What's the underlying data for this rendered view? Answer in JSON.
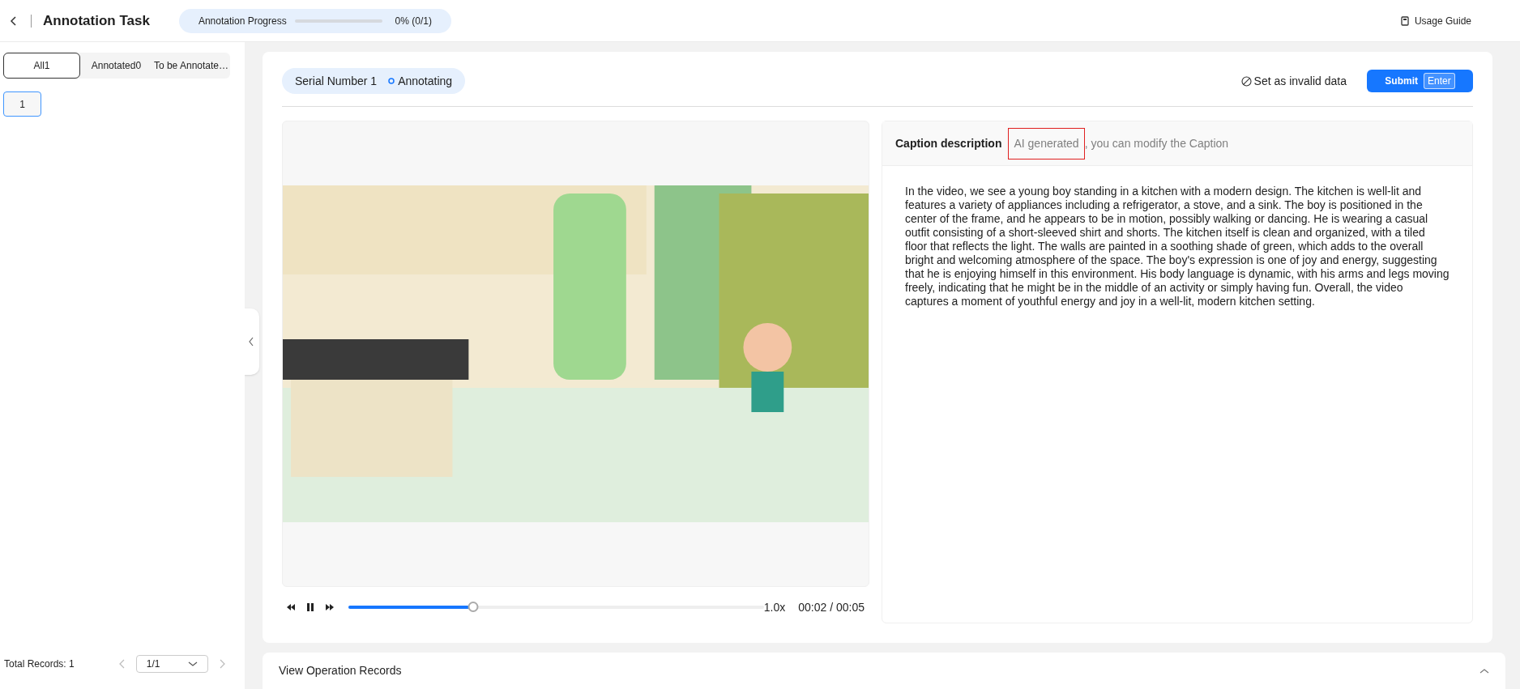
{
  "header": {
    "title": "Annotation Task",
    "progress": {
      "label": "Annotation Progress",
      "level": 0,
      "reading": "0% (0/1)"
    },
    "guide": "Usage Guide"
  },
  "sidebar": {
    "tabs": [
      {
        "label": "All1",
        "selected": true
      },
      {
        "label": "Annotated0",
        "selected": false
      },
      {
        "label": "To be Annotate…",
        "selected": false
      }
    ],
    "items": [
      {
        "label": "1",
        "selected": true
      }
    ],
    "total": "Total Records: 1",
    "page": "1/1"
  },
  "task": {
    "serial": "Serial Number 1",
    "status": "Annotating",
    "invalid": "Set as invalid data",
    "submit": "Submit",
    "submit_key": "Enter"
  },
  "player": {
    "level": 0.3,
    "speed": "1.0x",
    "time": "00:02 / 00:05"
  },
  "caption": {
    "title": "Caption description",
    "hint": [
      {
        "text": "AI generated",
        "highlighted": true
      },
      {
        "text": ", you can modify the Caption",
        "highlighted": false
      }
    ],
    "text": "In the video, we see a young boy standing in a kitchen with a modern design. The kitchen is well-lit and features a variety of appliances including a refrigerator, a stove, and a sink. The boy is positioned in the center of the frame, and he appears to be in motion, possibly walking or dancing. He is wearing a casual outfit consisting of a short-sleeved shirt and shorts. The kitchen itself is clean and organized, with a tiled floor that reflects the light. The walls are painted in a soothing shade of green, which adds to the overall bright and welcoming atmosphere of the space. The boy's expression is one of joy and energy, suggesting that he is enjoying himself in this environment. His body language is dynamic, with his arms and legs moving freely, indicating that he might be in the middle of an activity or simply having fun. Overall, the video captures a moment of youthful energy and joy in a well-lit, modern kitchen setting."
  },
  "records": {
    "title": "View Operation Records",
    "expanded": false
  }
}
